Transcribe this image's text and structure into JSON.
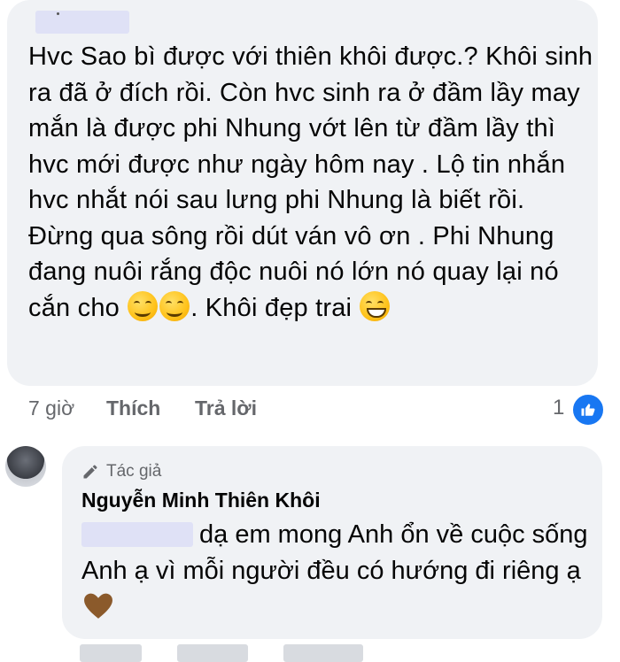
{
  "comment1": {
    "text": "Hvc Sao bì được với thiên khôi được.? Khôi sinh ra đã ở đích rồi. Còn hvc sinh ra ở đầm lầy may mắn là được phi Nhung vớt lên từ đầm lầy thì hvc mới được như ngày hôm nay . Lộ tin nhắn hvc nhắt nói sau lưng phi Nhung là biết rồi. Đừng qua sông rồi dút ván vô ơn . Phi Nhung đang nuôi rắng độc nuôi nó lớn nó quay lại nó cắn cho",
    "after_emoji": ". Khôi đẹp trai",
    "emojis": [
      "smiling-face-icon",
      "smiling-face-icon",
      "grinning-face-icon"
    ],
    "time": "7 giờ",
    "like_label": "Thích",
    "reply_label": "Trả lời",
    "reaction_count": "1"
  },
  "reply": {
    "badge": "Tác giả",
    "author": "Nguyễn Minh Thiên Khôi",
    "text": "dạ em mong Anh ổn về cuộc sống Anh ạ vì mỗi người đều có hướng đi riêng ạ",
    "emoji": "brown-heart-icon"
  },
  "colors": {
    "bubble": "#f0f2f5",
    "meta_text": "#65676b",
    "like_blue": "#1877f2",
    "redaction": "#dfe1f6"
  }
}
